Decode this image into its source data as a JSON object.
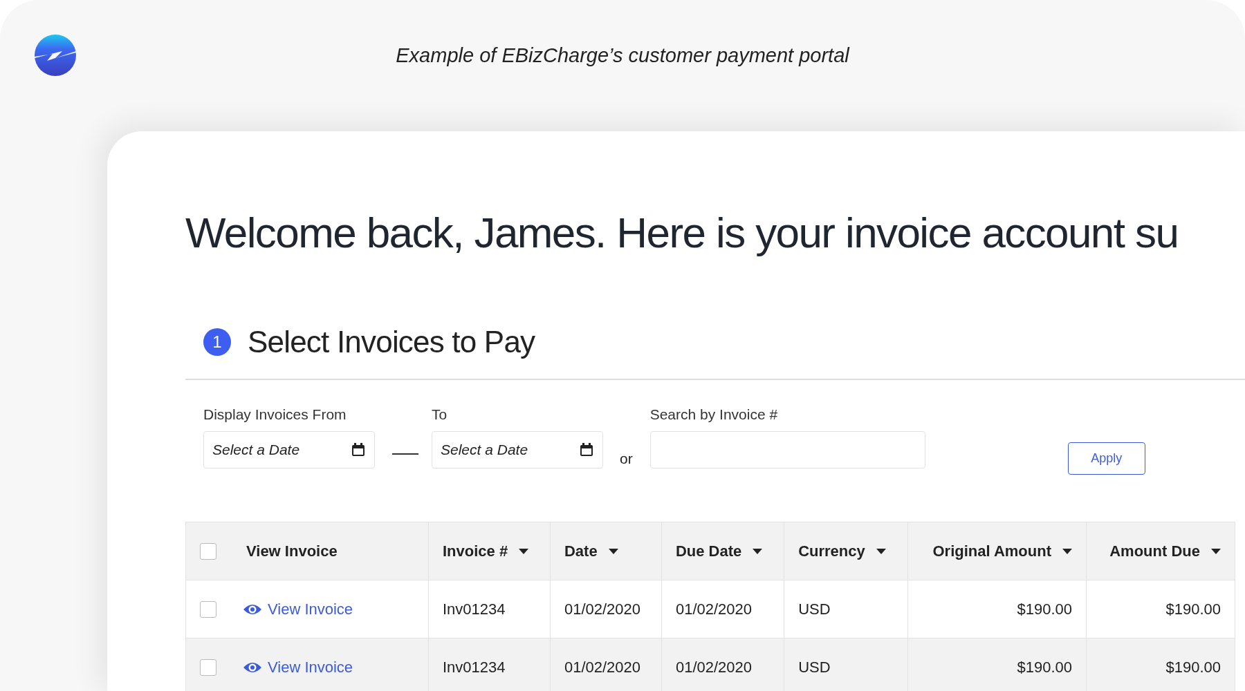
{
  "caption": "Example of EBizCharge’s customer payment portal",
  "heading": "Welcome back, James. Here is your invoice account su",
  "step": {
    "number": "1",
    "title": "Select Invoices to Pay"
  },
  "filters": {
    "from_label": "Display Invoices From",
    "from_placeholder": "Select a Date",
    "to_label": "To",
    "to_placeholder": "Select a Date",
    "or": "or",
    "search_label": "Search by Invoice #",
    "apply": "Apply"
  },
  "table": {
    "select_all_checked": false,
    "columns": [
      "View Invoice",
      "Invoice #",
      "Date",
      "Due Date",
      "Currency",
      "Original Amount",
      "Amount Due"
    ],
    "rows": [
      {
        "checked": false,
        "link": "View Invoice",
        "invoice": "Inv01234",
        "date": "01/02/2020",
        "due_date": "01/02/2020",
        "currency": "USD",
        "original_amount": "$190.00",
        "amount_due": "$190.00"
      },
      {
        "checked": false,
        "link": "View Invoice",
        "invoice": "Inv01234",
        "date": "01/02/2020",
        "due_date": "01/02/2020",
        "currency": "USD",
        "original_amount": "$190.00",
        "amount_due": "$190.00"
      }
    ]
  }
}
